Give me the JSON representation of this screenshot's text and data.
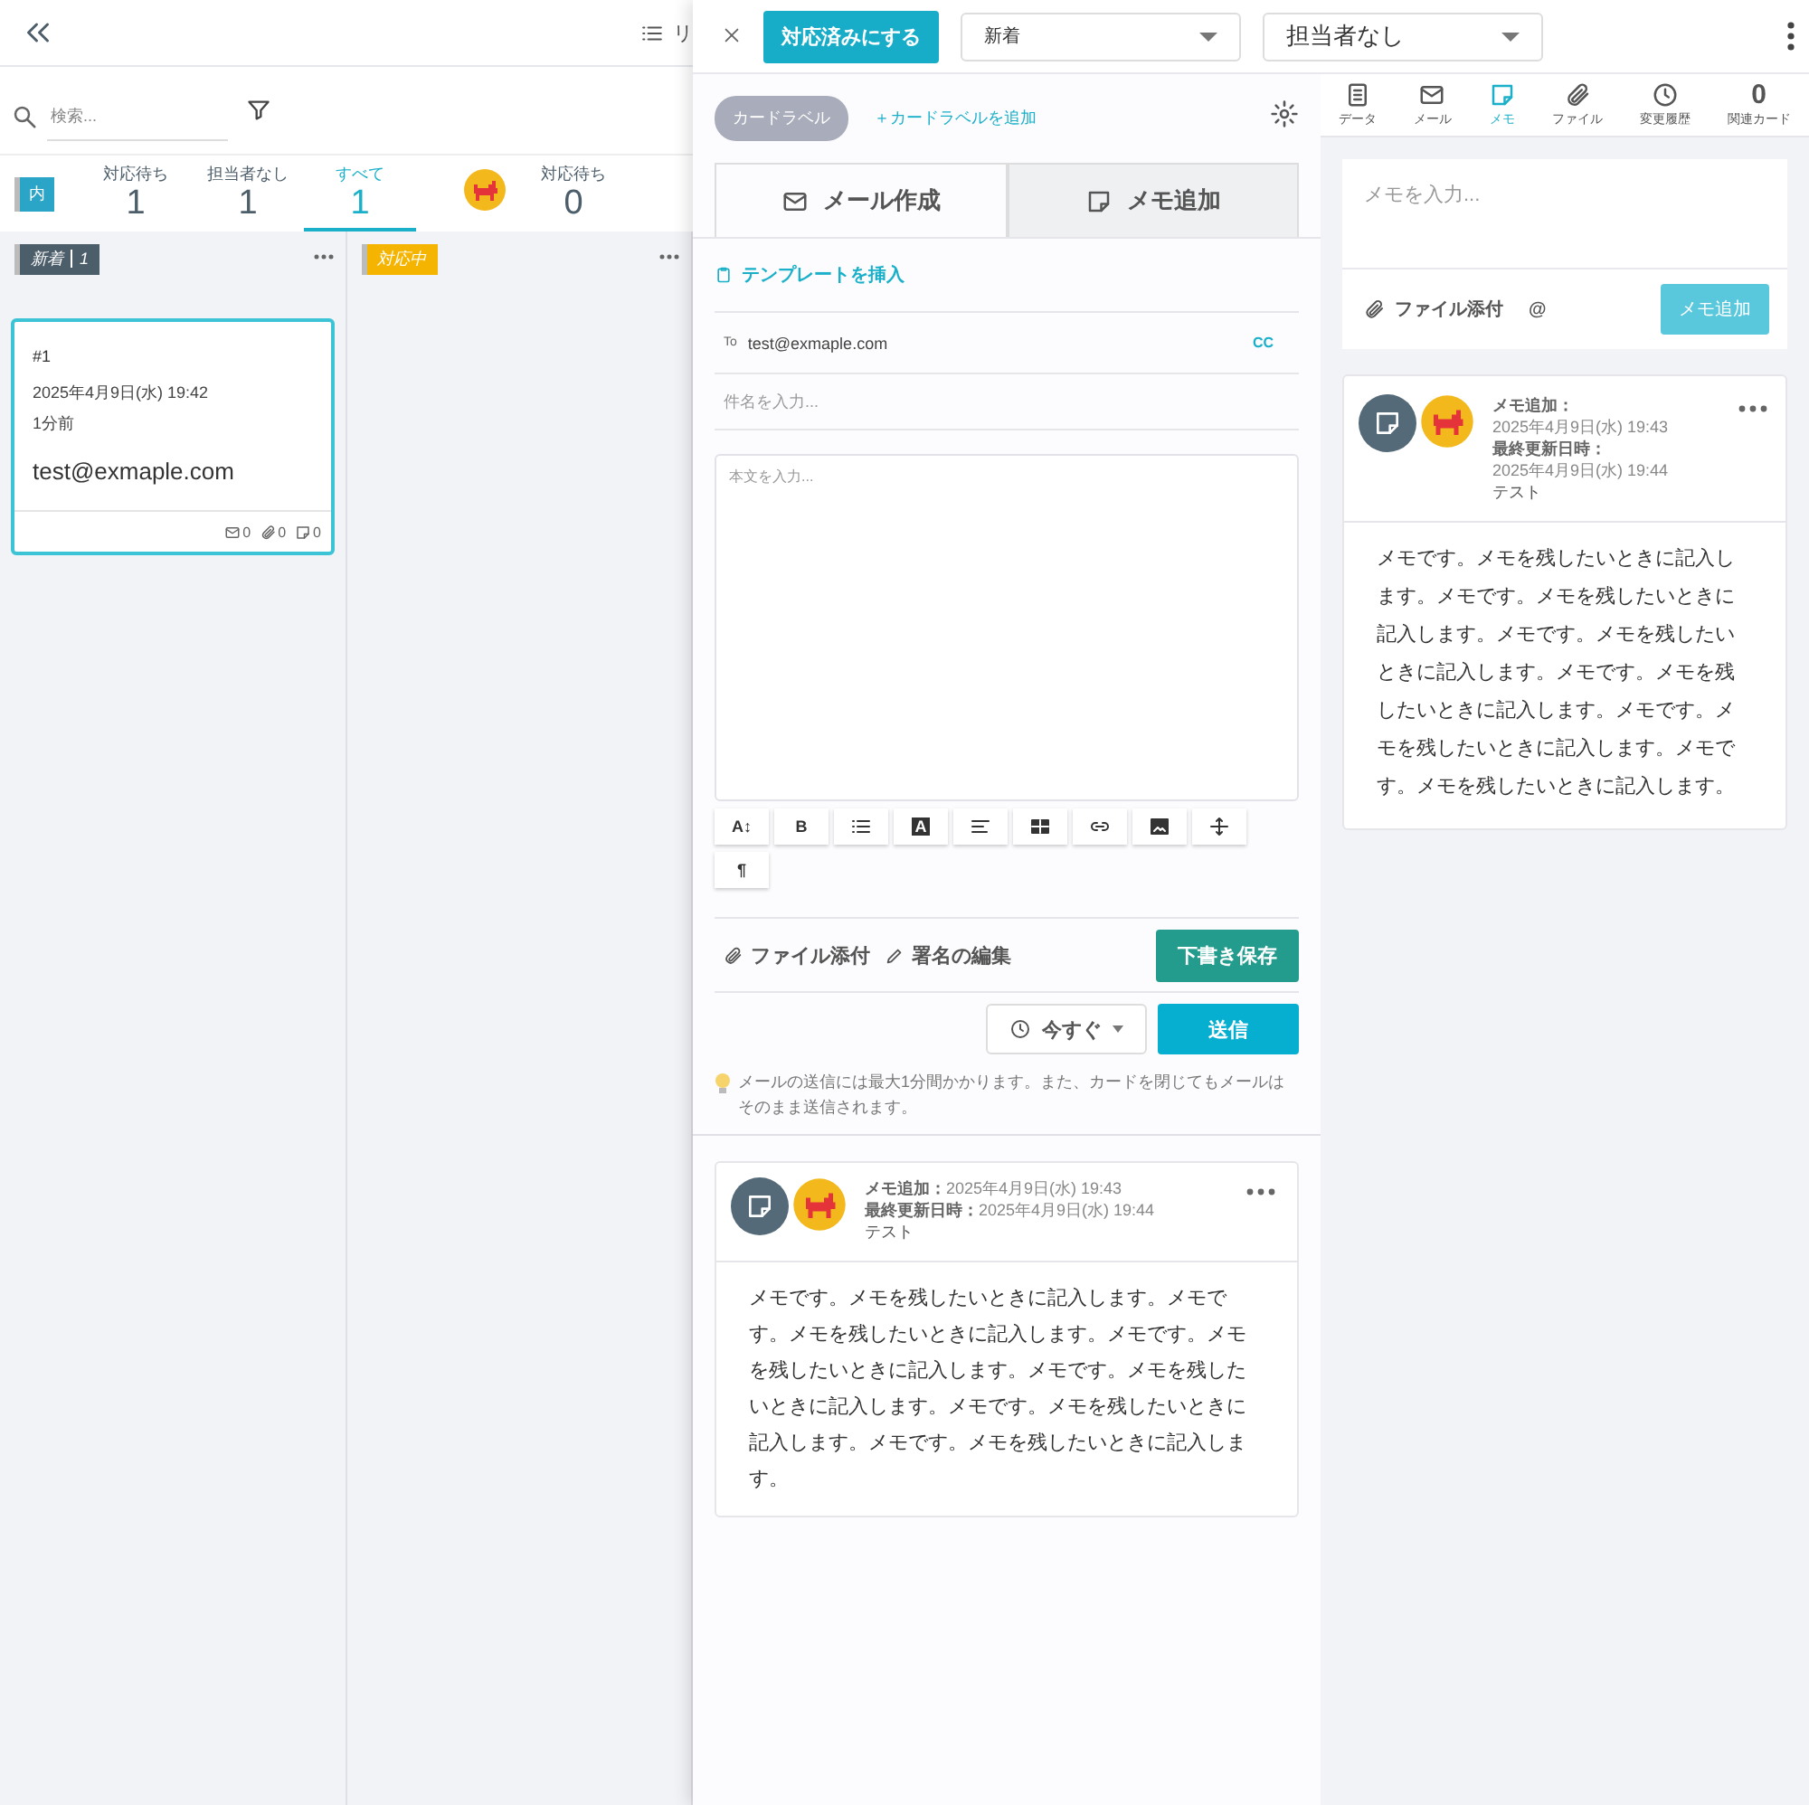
{
  "board": {
    "view_label": "リ",
    "search": {
      "placeholder": "検索..."
    },
    "stats": {
      "badge": "内",
      "tabs": [
        {
          "label": "対応待ち",
          "count": "1",
          "selected": false
        },
        {
          "label": "担当者なし",
          "count": "1",
          "selected": false
        },
        {
          "label": "すべて",
          "count": "1",
          "selected": true
        }
      ],
      "user_tab": {
        "label": "対応待ち",
        "count": "0"
      }
    },
    "columns": [
      {
        "title": "新着",
        "count": "1",
        "color": "#4d5e6b",
        "cards": [
          {
            "number": "#1",
            "date": "2025年4月9日(水) 19:42",
            "ago": "1分前",
            "email": "test@exmaple.com",
            "mails": "0",
            "files": "0",
            "memos": "0",
            "selected": true
          }
        ]
      },
      {
        "title": "対応中",
        "color": "#f5b400"
      }
    ]
  },
  "detail": {
    "done_button": "対応済みにする",
    "status_select": "新着",
    "assignee_select": "担当者なし",
    "card_label": "カードラベル",
    "add_label": "＋カードラベルを追加",
    "compose_tabs": [
      {
        "label": "メール作成",
        "kind": "mail",
        "selected": true
      },
      {
        "label": "メモ追加",
        "kind": "memo",
        "selected": false
      }
    ],
    "template_link": "テンプレートを挿入",
    "to_label": "To",
    "to_value": "test@exmaple.com",
    "cc": "CC",
    "subject_placeholder": "件名を入力...",
    "body_placeholder": "本文を入力...",
    "toolbar": [
      {
        "kind": "text",
        "label": "A↕"
      },
      {
        "kind": "text",
        "label": "B"
      },
      {
        "kind": "list"
      },
      {
        "kind": "boxed",
        "label": "A"
      },
      {
        "kind": "align"
      },
      {
        "kind": "table"
      },
      {
        "kind": "link"
      },
      {
        "kind": "image"
      },
      {
        "kind": "move"
      },
      {
        "kind": "text",
        "label": "¶"
      }
    ],
    "attach": "ファイル添付",
    "signature": "署名の編集",
    "draft_button": "下書き保存",
    "schedule": "今すぐ",
    "send_button": "送信",
    "note": "メールの送信には最大1分間かかります。また、カードを閉じてもメールはそのまま送信されます。",
    "memo": {
      "added_label": "メモ追加：",
      "added_date": "2025年4月9日(水) 19:43",
      "updated_label": "最終更新日時：",
      "updated_date": "2025年4月9日(水) 19:44",
      "author": "テスト",
      "body": "メモです。メモを残したいときに記入します。メモです。メモを残したいときに記入します。メモです。メモを残したいときに記入します。メモです。メモを残したいときに記入します。メモです。メモを残したいときに記入します。メモです。メモを残したいときに記入します。"
    }
  },
  "side": {
    "tabs": [
      {
        "label": "データ",
        "kind": "data",
        "selected": false
      },
      {
        "label": "メール",
        "kind": "mail",
        "selected": false
      },
      {
        "label": "メモ",
        "kind": "memo",
        "selected": true
      },
      {
        "label": "ファイル",
        "kind": "file",
        "selected": false
      },
      {
        "label": "変更履歴",
        "kind": "history",
        "selected": false
      },
      {
        "label": "関連カード",
        "kind": "count",
        "count": "0",
        "selected": false
      }
    ],
    "memo_placeholder": "メモを入力...",
    "attach": "ファイル添付",
    "mention": "@",
    "add_button": "メモ追加",
    "memo": {
      "added_label": "メモ追加：",
      "added_date": "2025年4月9日(水) 19:43",
      "updated_label": "最終更新日時：",
      "updated_date": "2025年4月9日(水) 19:44",
      "author": "テスト",
      "body": "メモです。メモを残したいときに記入します。メモです。メモを残したいときに記入します。メモです。メモを残したいときに記入します。メモです。メモを残したいときに記入します。メモです。メモを残したいときに記入します。メモです。メモを残したいときに記入します。"
    }
  }
}
